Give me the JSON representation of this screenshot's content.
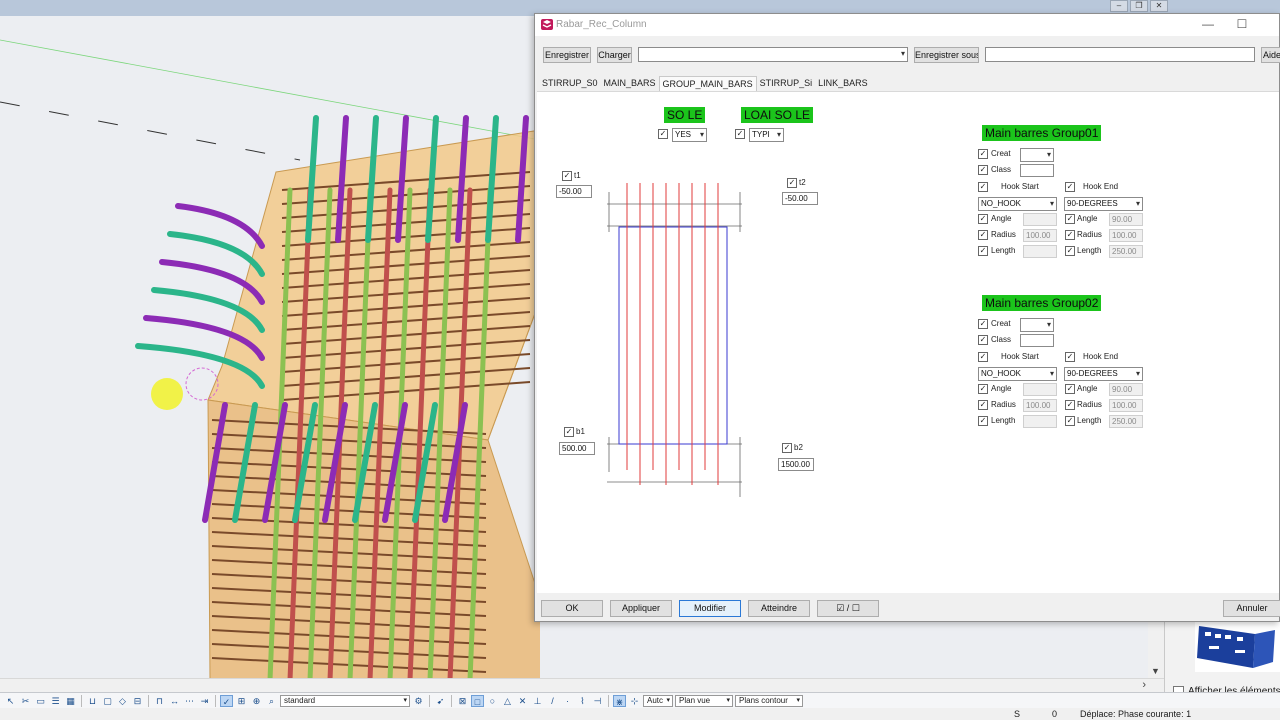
{
  "window": {
    "title": "Rabar_Rec_Column"
  },
  "toolbar": {
    "save_label": "Enregistrer",
    "load_label": "Charger",
    "load_combo_value": "",
    "save_as_label": "Enregistrer sous",
    "save_as_value": "",
    "help_label": "Aide"
  },
  "tabs": [
    {
      "label": "STIRRUP_S0"
    },
    {
      "label": "MAIN_BARS"
    },
    {
      "label": "GROUP_MAIN_BARS"
    },
    {
      "label": "STIRRUP_Si"
    },
    {
      "label": "LINK_BARS"
    }
  ],
  "active_tab": "GROUP_MAIN_BARS",
  "so_le": {
    "label": "SO LE",
    "value": "YES"
  },
  "loai_so_le": {
    "label": "LOAI SO LE",
    "value": "TYPI"
  },
  "offsets": {
    "t1": {
      "label": "t1",
      "value": "-50.00"
    },
    "t2": {
      "label": "t2",
      "value": "-50.00"
    },
    "b1": {
      "label": "b1",
      "value": "500.00"
    },
    "b2": {
      "label": "b2",
      "value": "1500.00"
    }
  },
  "groups": [
    {
      "title": "Main barres Group01",
      "creat_label": "Creat",
      "creat_value": "",
      "class_label": "Class",
      "class_value": "",
      "hook_start_label": "Hook Start",
      "hook_start_value": "NO_HOOK",
      "hook_end_label": "Hook End",
      "hook_end_value": "90-DEGREES",
      "angle_label": "Angle",
      "radius_label": "Radius",
      "length_label": "Length",
      "start_angle": "",
      "start_radius": "100.00",
      "start_length": "",
      "end_angle": "90.00",
      "end_radius": "100.00",
      "end_length": "250.00"
    },
    {
      "title": "Main barres Group02",
      "creat_label": "Creat",
      "creat_value": "",
      "class_label": "Class",
      "class_value": "",
      "hook_start_label": "Hook Start",
      "hook_start_value": "NO_HOOK",
      "hook_end_label": "Hook End",
      "hook_end_value": "90-DEGREES",
      "angle_label": "Angle",
      "radius_label": "Radius",
      "length_label": "Length",
      "start_angle": "",
      "start_radius": "100.00",
      "start_length": "",
      "end_angle": "90.00",
      "end_radius": "100.00",
      "end_length": "250.00"
    }
  ],
  "footer": {
    "ok": "OK",
    "apply": "Appliquer",
    "modify": "Modifier",
    "get": "Atteindre",
    "toggle": "☑ / ☐",
    "cancel": "Annuler"
  },
  "bottom_toolbar": {
    "view_filter": "standard",
    "snap_mode": "Autc",
    "plane": "Plan vue",
    "contour": "Plans contour"
  },
  "side_panel": {
    "show_elements_label": "Afficher les éléments ma"
  },
  "status": {
    "s_label": "S",
    "count": "0",
    "phase_text": "Déplace: Phase courante: 1"
  },
  "icons": {
    "dialog_app": "tekla-app-icon",
    "minimize": "minimize-icon",
    "maximize": "maximize-icon"
  }
}
